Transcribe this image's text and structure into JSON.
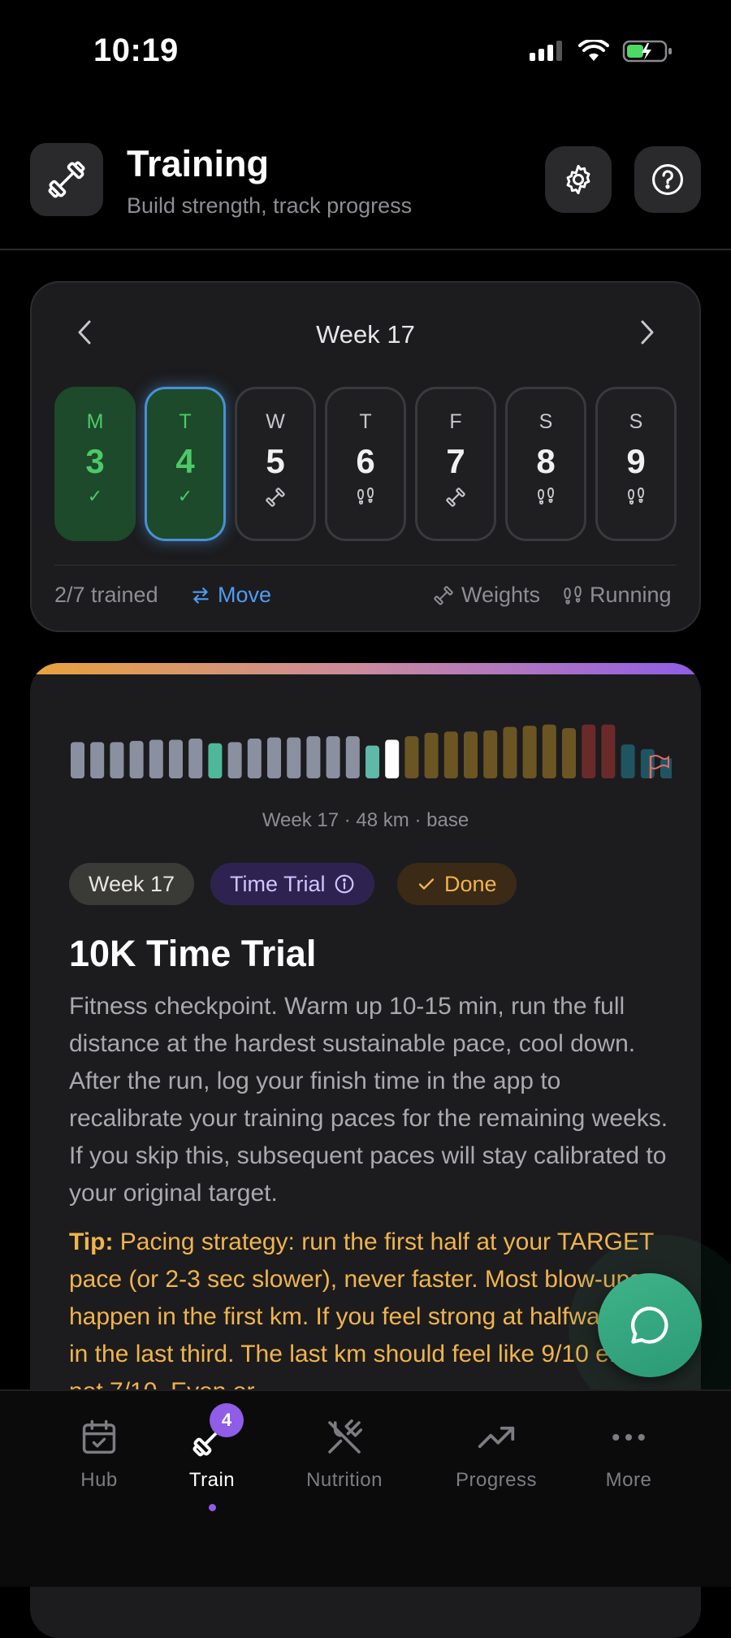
{
  "status": {
    "time": "10:19"
  },
  "header": {
    "title": "Training",
    "subtitle": "Build strength, track progress"
  },
  "week": {
    "title": "Week 17",
    "days": [
      {
        "letter": "M",
        "num": "3",
        "mark": "✓",
        "state": "done"
      },
      {
        "letter": "T",
        "num": "4",
        "mark": "✓",
        "state": "today"
      },
      {
        "letter": "W",
        "num": "5",
        "mark": "weights",
        "state": "planned"
      },
      {
        "letter": "T",
        "num": "6",
        "mark": "running",
        "state": "planned"
      },
      {
        "letter": "F",
        "num": "7",
        "mark": "weights",
        "state": "planned"
      },
      {
        "letter": "S",
        "num": "8",
        "mark": "running",
        "state": "planned"
      },
      {
        "letter": "S",
        "num": "9",
        "mark": "running",
        "state": "planned"
      }
    ],
    "trained": "2/7 trained",
    "move": "Move",
    "legend_weights": "Weights",
    "legend_running": "Running"
  },
  "workout": {
    "bars_caption": "Week 17 · 48 km · base",
    "pill_week": "Week 17",
    "pill_type": "Time Trial",
    "pill_status": "Done",
    "title": "10K Time Trial",
    "description": "Fitness checkpoint. Warm up 10-15 min, run the full distance at the hardest sustainable pace, cool down. After the run, log your finish time in the app to recalibrate your training paces for the remaining weeks. If you skip this, subsequent paces will stay calibrated to your original target.",
    "tip_label": "Tip:",
    "tip_text": "Pacing strategy: run the first half at your TARGET pace (or 2-3 sec slower), never faster. Most blow-ups happen in the first km. If you feel strong at halfway, lift in the last third. The last km should feel like 9/10 effort, not 7/10. Even or"
  },
  "weekly_bars": [
    {
      "h": 0.62,
      "c": "#8b90a0"
    },
    {
      "h": 0.62,
      "c": "#8b90a0"
    },
    {
      "h": 0.62,
      "c": "#8b90a0"
    },
    {
      "h": 0.64,
      "c": "#8b90a0"
    },
    {
      "h": 0.66,
      "c": "#8b90a0"
    },
    {
      "h": 0.66,
      "c": "#8b90a0"
    },
    {
      "h": 0.68,
      "c": "#8b90a0"
    },
    {
      "h": 0.6,
      "c": "#4fb89a"
    },
    {
      "h": 0.62,
      "c": "#8b90a0"
    },
    {
      "h": 0.68,
      "c": "#8b90a0"
    },
    {
      "h": 0.7,
      "c": "#8b90a0"
    },
    {
      "h": 0.7,
      "c": "#8b90a0"
    },
    {
      "h": 0.72,
      "c": "#8b90a0"
    },
    {
      "h": 0.72,
      "c": "#8b90a0"
    },
    {
      "h": 0.72,
      "c": "#8b90a0"
    },
    {
      "h": 0.56,
      "c": "#5fb8a8"
    },
    {
      "h": 0.66,
      "c": "#ffffff"
    },
    {
      "h": 0.72,
      "c": "#6b5522"
    },
    {
      "h": 0.78,
      "c": "#6b5522"
    },
    {
      "h": 0.8,
      "c": "#6b5522"
    },
    {
      "h": 0.8,
      "c": "#6b5522"
    },
    {
      "h": 0.82,
      "c": "#6b5522"
    },
    {
      "h": 0.88,
      "c": "#6b5522"
    },
    {
      "h": 0.9,
      "c": "#6b5522"
    },
    {
      "h": 0.92,
      "c": "#6b5522"
    },
    {
      "h": 0.86,
      "c": "#6b5522"
    },
    {
      "h": 0.92,
      "c": "#6b2a2a"
    },
    {
      "h": 0.92,
      "c": "#6b2a2a"
    },
    {
      "h": 0.58,
      "c": "#1f5560"
    },
    {
      "h": 0.5,
      "c": "#1f5560"
    },
    {
      "h": 0.34,
      "c": "#1f5560"
    }
  ],
  "tabs": [
    {
      "label": "Hub"
    },
    {
      "label": "Train",
      "badge": "4"
    },
    {
      "label": "Nutrition"
    },
    {
      "label": "Progress"
    },
    {
      "label": "More"
    }
  ],
  "colors": {
    "accent": "#8f5de8",
    "green": "#4cc968",
    "blue": "#4f9cf5",
    "amber": "#f0b44c"
  }
}
